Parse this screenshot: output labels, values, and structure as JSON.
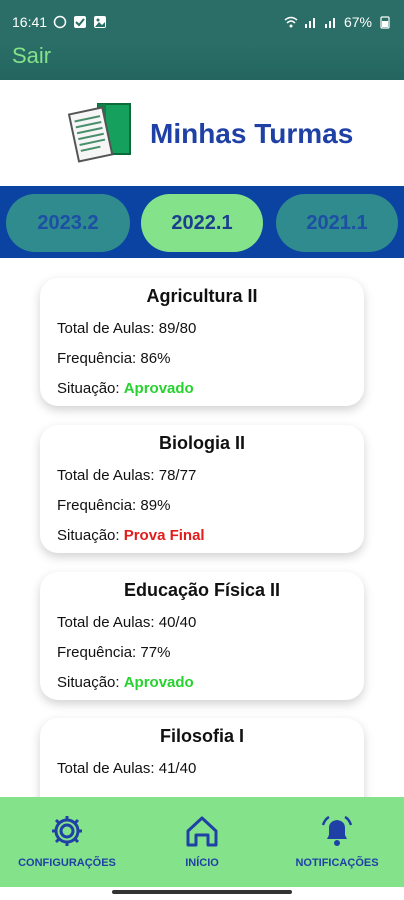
{
  "status_bar": {
    "time": "16:41",
    "battery": "67%"
  },
  "app_bar": {
    "exit_label": "Sair"
  },
  "header": {
    "title": "Minhas Turmas"
  },
  "semesters": {
    "tabs": [
      "2023.2",
      "2022.1",
      "2021.1"
    ],
    "selected": "2022.1"
  },
  "courses": [
    {
      "name": "Agricultura II",
      "total_label": "Total de Aulas:",
      "total": "89/80",
      "freq_label": "Frequência:",
      "frequency": "86%",
      "status_label": "Situação:",
      "status": "Aprovado"
    },
    {
      "name": "Biologia II",
      "total_label": "Total de Aulas:",
      "total": "78/77",
      "freq_label": "Frequência:",
      "frequency": "89%",
      "status_label": "Situação:",
      "status": "Prova Final"
    },
    {
      "name": "Educação Física II",
      "total_label": "Total de Aulas:",
      "total": "40/40",
      "freq_label": "Frequência:",
      "frequency": "77%",
      "status_label": "Situação:",
      "status": "Aprovado"
    },
    {
      "name": "Filosofia I",
      "total_label": "Total de Aulas:",
      "total": "41/40"
    }
  ],
  "bottom_nav": {
    "items": [
      {
        "label": "CONFIGURAÇÕES",
        "icon": "gear-icon"
      },
      {
        "label": "INÍCIO",
        "icon": "home-icon"
      },
      {
        "label": "NOTIFICAÇÕES",
        "icon": "bell-icon"
      }
    ]
  },
  "colors": {
    "status_bar": "#2a6e67",
    "band": "#0b43a3",
    "pill_active": "#84e38a",
    "pill_inactive": "#2f8b8d",
    "accent_blue": "#1f41a6",
    "approved": "#27d22f",
    "final": "#e21b1b",
    "nav_bg": "#84e38a"
  }
}
